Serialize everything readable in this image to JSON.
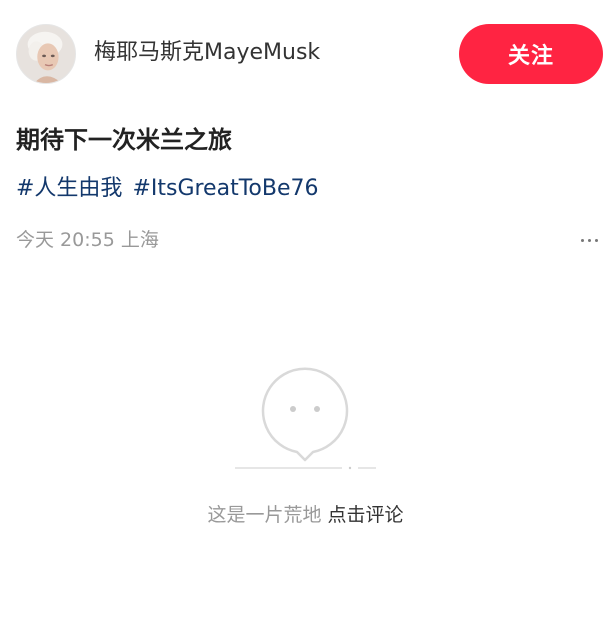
{
  "header": {
    "avatar_icon": "user-avatar",
    "username": "梅耶马斯克MayeMusk",
    "follow_label": "关注",
    "follow_color": "#ff2442"
  },
  "note": {
    "title": "期待下一次米兰之旅",
    "tags": [
      "#人生由我",
      "#ItsGreatToBe76"
    ],
    "date": "今天 20:55",
    "location": "上海",
    "more_icon": "more-horizontal-icon"
  },
  "comments": {
    "empty_icon": "empty-comment-face-icon",
    "empty_text": "这是一片荒地",
    "action_label": "点击评论"
  }
}
